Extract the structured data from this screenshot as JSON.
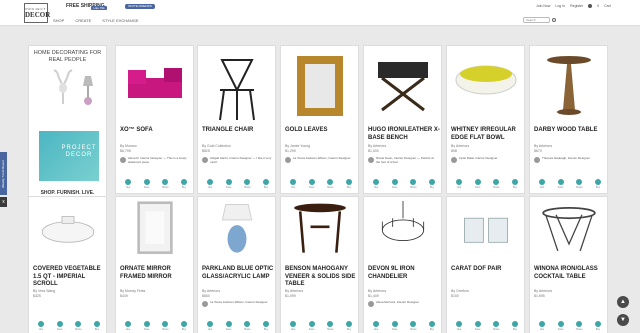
{
  "header": {
    "logo_top": "PROJECT",
    "logo_main": "DECOR",
    "shipping": "FREE SHIPPING",
    "fb_label": "Like 76k",
    "promo_label": "INVITE FRIENDS",
    "nav": [
      "SHOP",
      "CREATE",
      "STYLE EXCHANGE"
    ],
    "search_placeholder": "Search",
    "user_links": [
      "Join Now",
      "Log In",
      "Register"
    ],
    "cart_count": "0",
    "cart_label": "Cart"
  },
  "side_tab_label": "Weekly Trend Report",
  "side_box_label": "x",
  "ad": {
    "title": "HOME DECORATING FOR REAL PEOPLE",
    "bag_label": "PROJECT DECOR",
    "footer": "SHOP. FURNISH. LIVE."
  },
  "actions": [
    "Like",
    "Save",
    "Share",
    "Buy"
  ],
  "products": [
    {
      "title": "XO™ SOFA",
      "by": "By Moroso",
      "price": "$6,795",
      "comment_name": "Alexa R.",
      "comment": "Alexa R. Interior Designer — This is a lovely statement piece"
    },
    {
      "title": "TRIANGLE CHAIR",
      "by": "By Gubi Collection",
      "price": "$825",
      "comment_name": "Abigail H.",
      "comment": "Abigail Harris, Interior Designer — I like it very much"
    },
    {
      "title": "GOLD LEAVES",
      "by": "By Jamie Young",
      "price": "$1,299",
      "comment_name": "LaTosca J. W.",
      "comment": "La Tosca Jackson-Wilson, Interior Designer"
    },
    {
      "title": "HUGO IRON/LEATHER X-BASE BENCH",
      "by": "By Arteriors",
      "price": "$1,000",
      "comment_name": "Nicole D.",
      "comment": "Nicole Dean, Interior Designer — Perfect at the foot of a bed"
    },
    {
      "title": "WHITNEY IRREGULAR EDGE FLAT BOWL",
      "by": "By Arteriors",
      "price": "$98",
      "comment_name": "Lipsit D.",
      "comment": "Lipsit Dalal, Interior Designer"
    },
    {
      "title": "DARBY WOOD TABLE",
      "by": "By Arteriors",
      "price": "$670",
      "comment_name": "Theresa I.",
      "comment": "Theresa Isadeagh, Interior Designer"
    },
    {
      "title": "COVERED VEGETABLE 1.5 QT - IMPERIAL SCROLL",
      "by": "By Vera Wang",
      "price": "$325",
      "comment_name": "",
      "comment": ""
    },
    {
      "title": "ORNATE MIRROR FRAMED MIRROR",
      "by": "By Murray Feiss",
      "price": "$449",
      "comment_name": "",
      "comment": ""
    },
    {
      "title": "PARKLAND BLUE OPTIC GLASS/ACRYLIC LAMP",
      "by": "By Arteriors",
      "price": "$660",
      "comment_name": "La Tosca J.",
      "comment": "La Tosca Jackson-Wilson, Interior Designer"
    },
    {
      "title": "BENSON MAHOGANY VENEER & SOLIDS SIDE TABLE",
      "by": "By Arteriors",
      "price": "$1,099",
      "comment_name": "",
      "comment": ""
    },
    {
      "title": "DEVON 9L IRON CHANDELIER",
      "by": "By Arteriors",
      "price": "$1,449",
      "comment_name": "Alexa R.",
      "comment": "Alexa Rezvani, Interior Designer"
    },
    {
      "title": "CARAT DOF PAIR",
      "by": "By Orrefors",
      "price": "$100",
      "comment_name": "",
      "comment": ""
    },
    {
      "title": "WINONA IRON/GLASS COCKTAIL TABLE",
      "by": "By Arteriors",
      "price": "$1,595",
      "comment_name": "",
      "comment": ""
    }
  ],
  "colors": {
    "accent": "#3ea6a6",
    "brand": "#4a66a0"
  }
}
